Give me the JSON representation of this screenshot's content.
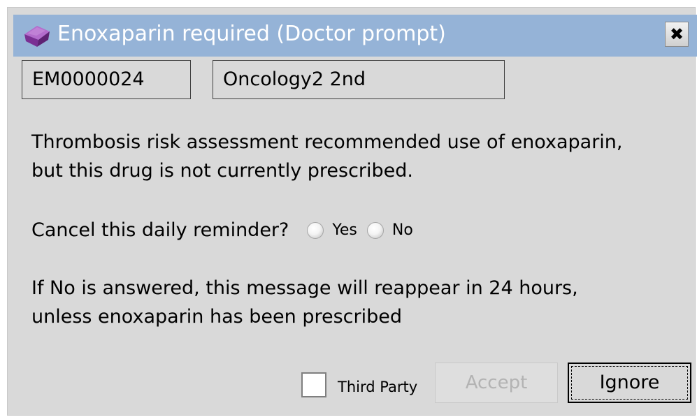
{
  "dialog": {
    "title": "Enoxaparin required (Doctor prompt)",
    "icon": "purple-gem-icon",
    "close_icon": "close-x-icon"
  },
  "patient": {
    "id": "EM0000024",
    "ward": "Oncology2 2nd"
  },
  "message": {
    "line1": "Thrombosis risk assessment recommended use of enoxaparin,",
    "line2": "but this drug is not currently prescribed.",
    "question": "Cancel this daily reminder?",
    "options": [
      "Yes",
      "No"
    ],
    "selected_option": null,
    "note_line1": "If No is answered, this message will reappear in 24 hours,",
    "note_line2": "unless enoxaparin has been prescribed"
  },
  "footer": {
    "third_party_label": "Third Party",
    "third_party_checked": false,
    "accept_label": "Accept",
    "accept_enabled": false,
    "ignore_label": "Ignore"
  },
  "colors": {
    "titlebar": "#95b3d7",
    "dialog_background": "#d9d9d9",
    "icon_purple": "#8e3fa8",
    "disabled_text": "#b3b3b3"
  }
}
